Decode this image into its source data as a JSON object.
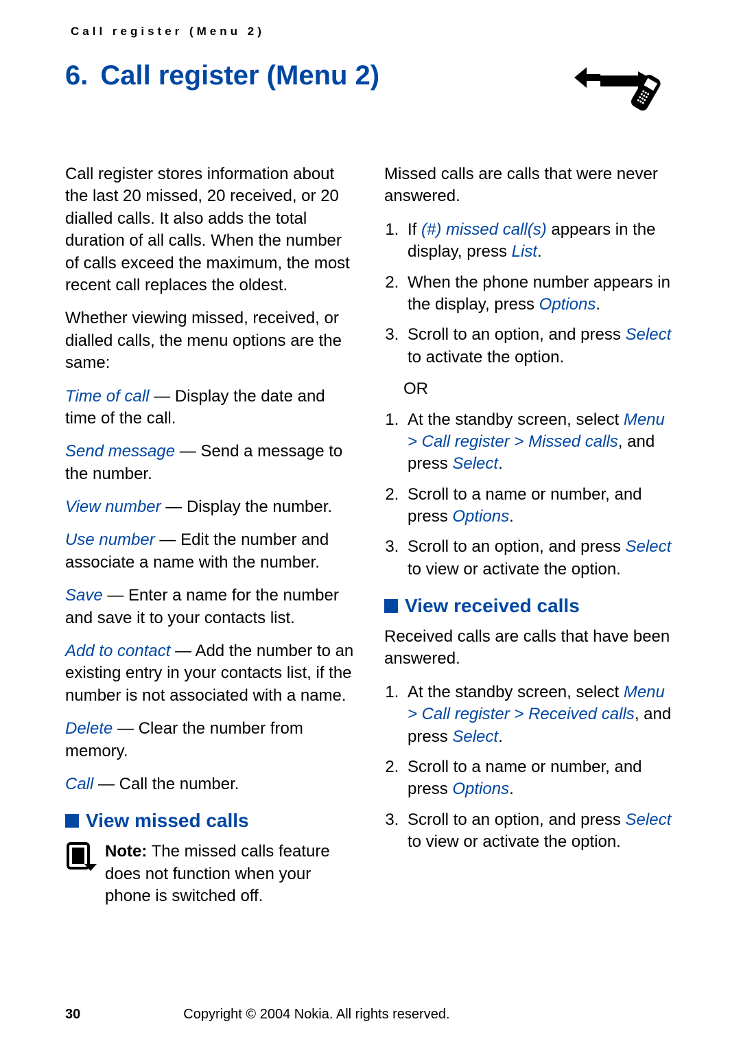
{
  "header_small": "Call register (Menu 2)",
  "chapter": {
    "num": "6.",
    "title": "Call register (Menu 2)"
  },
  "intro1": "Call register stores information about the last 20 missed, 20 received, or 20 dialled calls. It also adds the total duration of all calls. When the number of calls exceed the maximum, the most recent call replaces the oldest.",
  "intro2": "Whether viewing missed, received, or dialled calls, the menu options are the same:",
  "opts": {
    "time": {
      "t": "Time of call",
      "d": " — Display the date and time of the call."
    },
    "send": {
      "t": "Send message",
      "d": " — Send a message to the number."
    },
    "view": {
      "t": "View number",
      "d": " — Display the number."
    },
    "use": {
      "t": "Use number",
      "d": " — Edit the number and associate a name with the number."
    },
    "save": {
      "t": "Save",
      "d": " — Enter a name for the number and save it to your contacts list."
    },
    "add": {
      "t": "Add to contact",
      "d": " — Add the number to an existing entry in your contacts list, if the number is not associated with a name."
    },
    "del": {
      "t": "Delete",
      "d": " — Clear the number from memory."
    },
    "call": {
      "t": "Call",
      "d": " — Call the number."
    }
  },
  "sec_missed": "View missed calls",
  "note_label": "Note:",
  "note_body": " The missed calls feature does not function when your phone is switched off.",
  "missed_desc": "Missed calls are calls that were never answered.",
  "m1a": "If ",
  "m1b": "(#) missed call(s)",
  "m1c": " appears in the display, press ",
  "m1d": "List",
  "m1e": ".",
  "m2a": "When the phone number appears in the display, press ",
  "m2b": "Options",
  "m2c": ".",
  "m3a": "Scroll to an option, and press ",
  "m3b": "Select",
  "m3c": " to activate the option.",
  "or_text": "OR",
  "s1a": "At the standby screen, select ",
  "s1b": "Menu > Call register > Missed calls",
  "s1c": ", and press ",
  "s1d": "Select",
  "s1e": ".",
  "s2a": "Scroll to a name or number, and press ",
  "s2b": "Options",
  "s2c": ".",
  "s3a": "Scroll to an option, and press ",
  "s3b": "Select",
  "s3c": " to view or activate the option.",
  "sec_received": "View received calls",
  "rec_desc": "Received calls are calls that have been answered.",
  "r1a": "At the standby screen, select ",
  "r1b": "Menu > Call register > Received calls",
  "r1c": ", and press ",
  "r1d": "Select",
  "r1e": ".",
  "r2a": "Scroll to a name or number, and press ",
  "r2b": "Options",
  "r2c": ".",
  "r3a": "Scroll to an option, and press ",
  "r3b": "Select",
  "r3c": " to view or activate the option.",
  "page_num": "30",
  "copyright": "Copyright © 2004 Nokia. All rights reserved."
}
